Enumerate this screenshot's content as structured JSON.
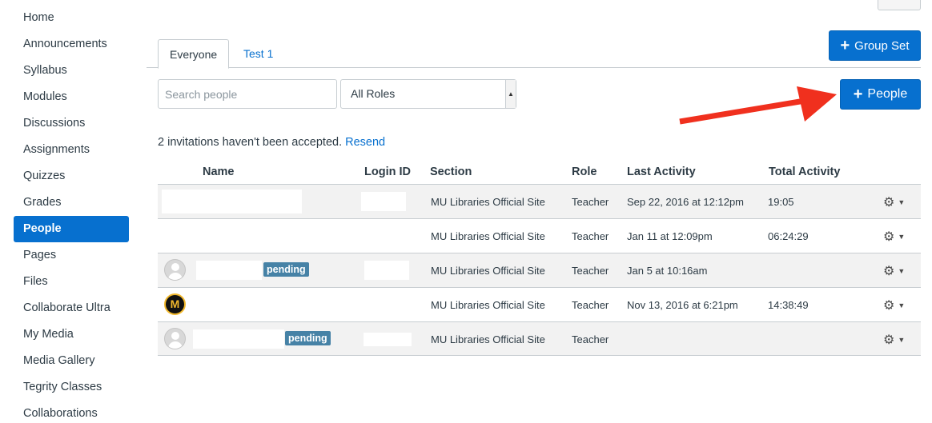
{
  "sidebar": {
    "items": [
      {
        "label": "Home"
      },
      {
        "label": "Announcements"
      },
      {
        "label": "Syllabus"
      },
      {
        "label": "Modules"
      },
      {
        "label": "Discussions"
      },
      {
        "label": "Assignments"
      },
      {
        "label": "Quizzes"
      },
      {
        "label": "Grades"
      },
      {
        "label": "People"
      },
      {
        "label": "Pages"
      },
      {
        "label": "Files"
      },
      {
        "label": "Collaborate Ultra"
      },
      {
        "label": "My Media"
      },
      {
        "label": "Media Gallery"
      },
      {
        "label": "Tegrity Classes"
      },
      {
        "label": "Collaborations"
      }
    ],
    "active": "People"
  },
  "tabs": [
    {
      "label": "Everyone"
    },
    {
      "label": "Test 1"
    }
  ],
  "buttons": {
    "group_set": "Group Set",
    "people": "People"
  },
  "search": {
    "placeholder": "Search people",
    "value": ""
  },
  "role_filter": {
    "selected": "All Roles"
  },
  "invitations": {
    "text": "2 invitations haven't been accepted.",
    "link": "Resend"
  },
  "table": {
    "headers": {
      "name": "Name",
      "login_id": "Login ID",
      "section": "Section",
      "role": "Role",
      "last_activity": "Last Activity",
      "total_activity": "Total Activity"
    },
    "rows": [
      {
        "section": "MU Libraries Official Site",
        "role": "Teacher",
        "last_activity": "Sep 22, 2016 at 12:12pm",
        "total_activity": "19:05",
        "pending": ""
      },
      {
        "section": "MU Libraries Official Site",
        "role": "Teacher",
        "last_activity": "Jan 11 at 12:09pm",
        "total_activity": "06:24:29",
        "pending": ""
      },
      {
        "section": "MU Libraries Official Site",
        "role": "Teacher",
        "last_activity": "Jan 5 at 10:16am",
        "total_activity": "",
        "pending": "pending"
      },
      {
        "section": "MU Libraries Official Site",
        "role": "Teacher",
        "last_activity": "Nov 13, 2016 at 6:21pm",
        "total_activity": "14:38:49",
        "pending": ""
      },
      {
        "section": "MU Libraries Official Site",
        "role": "Teacher",
        "last_activity": "",
        "total_activity": "",
        "pending": "pending"
      }
    ]
  },
  "colors": {
    "accent": "#0770cf",
    "pending_badge": "#4682a6",
    "annotation_arrow": "#f0301e"
  },
  "icons": {
    "gear": "gear-icon",
    "caret": "caret-down-icon",
    "plus": "plus-icon"
  }
}
